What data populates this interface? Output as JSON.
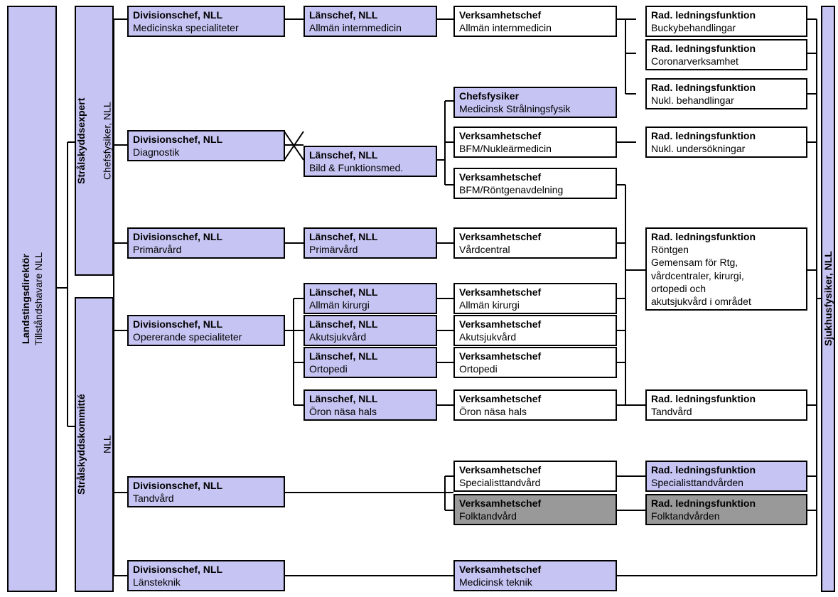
{
  "left": {
    "landstingsdirektor": {
      "title": "Landstingsdirektör",
      "sub": "Tillståndshavare NLL"
    },
    "stralskyddsexpert": {
      "title": "Strålskyddsexpert",
      "sub": "Chefsfysiker, NLL"
    },
    "stralskyddskommitte": {
      "title": "Strålskyddskommitté",
      "sub": "NLL"
    }
  },
  "right": {
    "sjukhusfysiker": {
      "title": "Sjukhusfysiker, NLL",
      "sub": ""
    }
  },
  "div": {
    "med": {
      "title": "Divisionschef, NLL",
      "sub": "Medicinska specialiteter"
    },
    "diag": {
      "title": "Divisionschef, NLL",
      "sub": "Diagnostik"
    },
    "primar": {
      "title": "Divisionschef, NLL",
      "sub": "Primärvård"
    },
    "oper": {
      "title": "Divisionschef, NLL",
      "sub": "Opererande specialiteter"
    },
    "tand": {
      "title": "Divisionschef, NLL",
      "sub": "Tandvård"
    },
    "lansteknik": {
      "title": "Divisionschef, NLL",
      "sub": "Länsteknik"
    }
  },
  "lans": {
    "internmed": {
      "title": "Länschef, NLL",
      "sub": "Allmän internmedicin"
    },
    "bfm": {
      "title": "Länschef, NLL",
      "sub": "Bild & Funktionsmed."
    },
    "primar": {
      "title": "Länschef, NLL",
      "sub": "Primärvård"
    },
    "kirurgi": {
      "title": "Länschef, NLL",
      "sub": "Allmän kirurgi"
    },
    "akut": {
      "title": "Länschef, NLL",
      "sub": "Akutsjukvård"
    },
    "ortopedi": {
      "title": "Länschef, NLL",
      "sub": "Ortopedi"
    },
    "oron": {
      "title": "Länschef, NLL",
      "sub": "Öron näsa hals"
    }
  },
  "verk": {
    "internmed": {
      "title": "Verksamhetschef",
      "sub": "Allmän internmedicin"
    },
    "chefsfysiker": {
      "title": "Chefsfysiker",
      "sub": "Medicinsk Strålningsfysik"
    },
    "bfmnukl": {
      "title": "Verksamhetschef",
      "sub": "BFM/Nukleärmedicin"
    },
    "bfmrtg": {
      "title": "Verksamhetschef",
      "sub": "BFM/Röntgenavdelning"
    },
    "vardcentral": {
      "title": "Verksamhetschef",
      "sub": "Vårdcentral"
    },
    "kirurgi": {
      "title": "Verksamhetschef",
      "sub": "Allmän kirurgi"
    },
    "akut": {
      "title": "Verksamhetschef",
      "sub": "Akutsjukvård"
    },
    "ortopedi": {
      "title": "Verksamhetschef",
      "sub": "Ortopedi"
    },
    "oron": {
      "title": "Verksamhetschef",
      "sub": "Öron näsa hals"
    },
    "spectand": {
      "title": "Verksamhetschef",
      "sub": "Specialisttandvård"
    },
    "folktand": {
      "title": "Verksamhetschef",
      "sub": "Folktandvård"
    },
    "medteknik": {
      "title": "Verksamhetschef",
      "sub": "Medicinsk teknik"
    }
  },
  "rad": {
    "bucky": {
      "title": "Rad. ledningsfunktion",
      "sub": "Buckybehandlingar"
    },
    "coronar": {
      "title": "Rad. ledningsfunktion",
      "sub": "Coronarverksamhet"
    },
    "nuklbeh": {
      "title": "Rad. ledningsfunktion",
      "sub": "Nukl. behandlingar"
    },
    "nuklund": {
      "title": "Rad. ledningsfunktion",
      "sub": "Nukl. undersökningar"
    },
    "rontgen": {
      "title": "Rad. ledningsfunktion",
      "sub": "Röntgen",
      "extra1": "Gemensam för Rtg,",
      "extra2": "vårdcentraler, kirurgi,",
      "extra3": "ortopedi och",
      "extra4": "akutsjukvård i området"
    },
    "tandvard": {
      "title": "Rad. ledningsfunktion",
      "sub": "Tandvård"
    },
    "spectand": {
      "title": "Rad. ledningsfunktion",
      "sub": "Specialisttandvården"
    },
    "folktand": {
      "title": "Rad. ledningsfunktion",
      "sub": "Folktandvården"
    }
  }
}
